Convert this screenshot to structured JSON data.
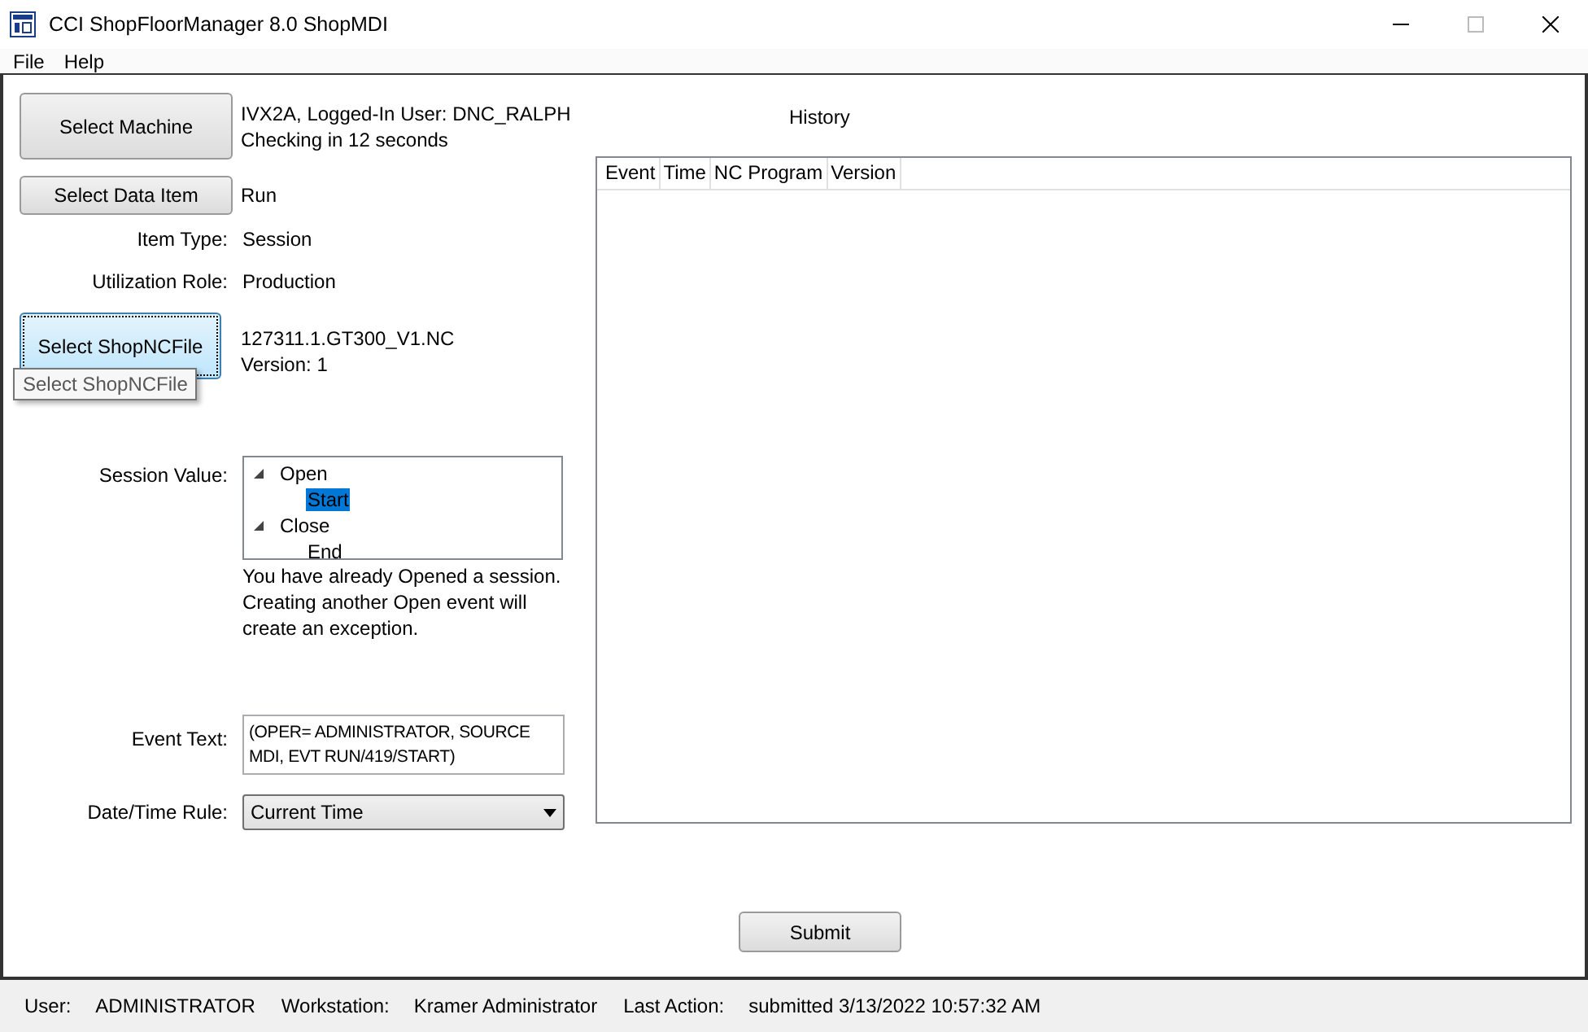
{
  "window": {
    "title": "CCI ShopFloorManager 8.0 ShopMDI"
  },
  "menu": [
    "File",
    "Help"
  ],
  "machine": {
    "button": "Select Machine",
    "lines": [
      "IVX2A, Logged-In User: DNC_RALPH",
      "Checking in 12 seconds"
    ]
  },
  "data_item": {
    "button": "Select Data Item",
    "value": "Run"
  },
  "fields": [
    {
      "label": "Item Type:",
      "value": "Session"
    },
    {
      "label": "Utilization Role:",
      "value": "Production"
    }
  ],
  "nc_file": {
    "button": "Select ShopNCFile",
    "lines": [
      "127311.1.GT300_V1.NC",
      "Version: 1"
    ],
    "tooltip": "Select ShopNCFile"
  },
  "session": {
    "label": "Session Value:",
    "tree": [
      {
        "label": "Open",
        "expanded": true,
        "selected": false,
        "children": [
          {
            "label": "Start",
            "selected": true
          }
        ]
      },
      {
        "label": "Close",
        "expanded": true,
        "selected": false,
        "children": [
          {
            "label": "End",
            "selected": false
          }
        ]
      }
    ],
    "warning": "You have already Opened a session. Creating another Open event will create an exception."
  },
  "event_text": {
    "label": "Event Text:",
    "value": "(OPER= ADMINISTRATOR, SOURCE MDI, EVT RUN/419/START)"
  },
  "date_rule": {
    "label": "Date/Time Rule:",
    "value": "Current Time"
  },
  "history": {
    "title": "History",
    "columns": [
      "Event",
      "Time",
      "NC Program",
      "Version"
    ]
  },
  "submit": "Submit",
  "status_bar": [
    {
      "label": "User:",
      "value": "ADMINISTRATOR"
    },
    {
      "label": "Workstation:",
      "value": "Kramer Administrator"
    },
    {
      "label": "Last Action:",
      "value": "submitted 3/13/2022 10:57:32 AM"
    }
  ]
}
